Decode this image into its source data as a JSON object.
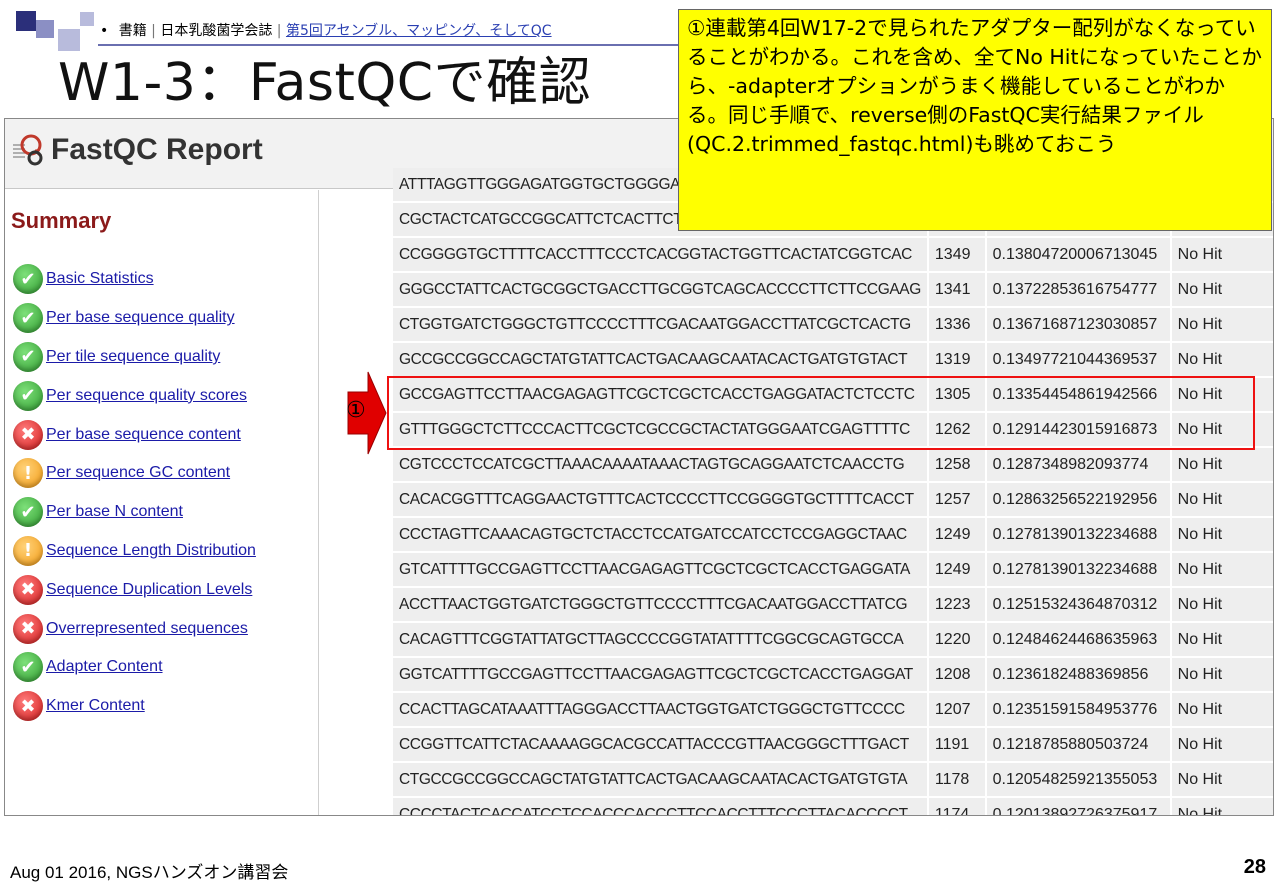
{
  "slide": {
    "breadcrumb": {
      "bullet": "•",
      "part1": "書籍",
      "sep1": "|",
      "part2": "日本乳酸菌学会誌",
      "sep2": "|",
      "link": "第5回アセンブル、マッピング、そしてQC"
    },
    "title": "W1-3：FastQCで確認",
    "callout": "①連載第4回W17-2で見られたアダプター配列がなくなっていることがわかる。これを含め、全てNo Hitになっていたことから、-adapterオプションがうまく機能していることがわかる。同じ手順で、reverse側のFastQC実行結果ファイル(QC.2.trimmed_fastqc.html)も眺めておこう",
    "marker": "①",
    "footer": "Aug 01 2016, NGSハンズオン講習会",
    "page_number": "28",
    "colors": {
      "callout_bg": "#ffff00",
      "highlight_border": "#ee1111",
      "arrow": "#e00000",
      "summary_title": "#8b1a1a",
      "link": "#1b1ba8"
    }
  },
  "report": {
    "title": "FastQC Report",
    "logo_icon": "fastqc-logo-icon",
    "summary_title": "Summary",
    "modules": [
      {
        "label": "Basic Statistics",
        "status": "pass"
      },
      {
        "label": "Per base sequence quality",
        "status": "pass"
      },
      {
        "label": "Per tile sequence quality",
        "status": "pass"
      },
      {
        "label": "Per sequence quality scores",
        "status": "pass"
      },
      {
        "label": "Per base sequence content",
        "status": "fail"
      },
      {
        "label": "Per sequence GC content",
        "status": "warn"
      },
      {
        "label": "Per base N content",
        "status": "pass"
      },
      {
        "label": "Sequence Length Distribution",
        "status": "warn"
      },
      {
        "label": "Sequence Duplication Levels",
        "status": "fail"
      },
      {
        "label": "Overrepresented sequences",
        "status": "fail"
      },
      {
        "label": "Adapter Content",
        "status": "pass"
      },
      {
        "label": "Kmer Content",
        "status": "fail"
      }
    ],
    "rows": [
      {
        "seq": "ATTTAGGTTGGGAGATGGTGCTGGGGATCTGAGGAAGGTTCCCCCTAG",
        "count": "",
        "pct": "",
        "src": ""
      },
      {
        "seq": "CGCTACTCATGCCGGCATTCTCACTTCTAAGCTCATGGCCCCGTTCCCC",
        "count": "",
        "pct": "",
        "src": ""
      },
      {
        "seq": "CCGGGGTGCTTTTCACCTTTCCCTCACGGTACTGGTTCACTATCGGTCAC",
        "count": "1349",
        "pct": "0.13804720006713045",
        "src": "No Hit"
      },
      {
        "seq": "GGGCCTATTCACTGCGGCTGACCTTGCGGTCAGCACCCCTTCTTCCGAAG",
        "count": "1341",
        "pct": "0.13722853616754777",
        "src": "No Hit"
      },
      {
        "seq": "CTGGTGATCTGGGCTGTTCCCCTTTCGACAATGGACCTTATCGCTCACTG",
        "count": "1336",
        "pct": "0.13671687123030857",
        "src": "No Hit"
      },
      {
        "seq": "GCCGCCGGCCAGCTATGTATTCACTGACAAGCAATACACTGATGTGTACT",
        "count": "1319",
        "pct": "0.13497721044369537",
        "src": "No Hit"
      },
      {
        "seq": "GCCGAGTTCCTTAACGAGAGTTCGCTCGCTCACCTGAGGATACTCTCCTC",
        "count": "1305",
        "pct": "0.13354454861942566",
        "src": "No Hit"
      },
      {
        "seq": "GTTTGGGCTCTTCCCACTTCGCTCGCCGCTACTATGGGAATCGAGTTTTC",
        "count": "1262",
        "pct": "0.12914423015916873",
        "src": "No Hit"
      },
      {
        "seq": "CGTCCCTCCATCGCTTAAACAAAATAAACTAGTGCAGGAATCTCAACCTG",
        "count": "1258",
        "pct": "0.1287348982093774",
        "src": "No Hit"
      },
      {
        "seq": "CACACGGTTTCAGGAACTGTTTCACTCCCCTTCCGGGGTGCTTTTCACCT",
        "count": "1257",
        "pct": "0.12863256522192956",
        "src": "No Hit"
      },
      {
        "seq": "CCCTAGTTCAAACAGTGCTCTACCTCCATGATCCATCCTCCGAGGCTAAC",
        "count": "1249",
        "pct": "0.12781390132234688",
        "src": "No Hit"
      },
      {
        "seq": "GTCATTTTGCCGAGTTCCTTAACGAGAGTTCGCTCGCTCACCTGAGGATA",
        "count": "1249",
        "pct": "0.12781390132234688",
        "src": "No Hit"
      },
      {
        "seq": "ACCTTAACTGGTGATCTGGGCTGTTCCCCTTTCGACAATGGACCTTATCG",
        "count": "1223",
        "pct": "0.12515324364870312",
        "src": "No Hit"
      },
      {
        "seq": "CACAGTTTCGGTATTATGCTTAGCCCCGGTATATTTTCGGCGCAGTGCCA",
        "count": "1220",
        "pct": "0.12484624468635963",
        "src": "No Hit"
      },
      {
        "seq": "GGTCATTTTGCCGAGTTCCTTAACGAGAGTTCGCTCGCTCACCTGAGGAT",
        "count": "1208",
        "pct": "0.1236182488369856",
        "src": "No Hit"
      },
      {
        "seq": "CCACTTAGCATAAATTTAGGGACCTTAACTGGTGATCTGGGCTGTTCCCC",
        "count": "1207",
        "pct": "0.12351591584953776",
        "src": "No Hit"
      },
      {
        "seq": "CCGGTTCATTCTACAAAAGGCACGCCATTACCCGTTAACGGGCTTTGACT",
        "count": "1191",
        "pct": "0.1218785880503724",
        "src": "No Hit"
      },
      {
        "seq": "CTGCCGCCGGCCAGCTATGTATTCACTGACAAGCAATACACTGATGTGTA",
        "count": "1178",
        "pct": "0.12054825921355053",
        "src": "No Hit"
      },
      {
        "seq": "CCCCTACTCACCATCCTCCACCCACCCTTCCACCTTTCCCTTACACCCCT",
        "count": "1174",
        "pct": "0.12013892726375917",
        "src": "No Hit"
      }
    ]
  }
}
